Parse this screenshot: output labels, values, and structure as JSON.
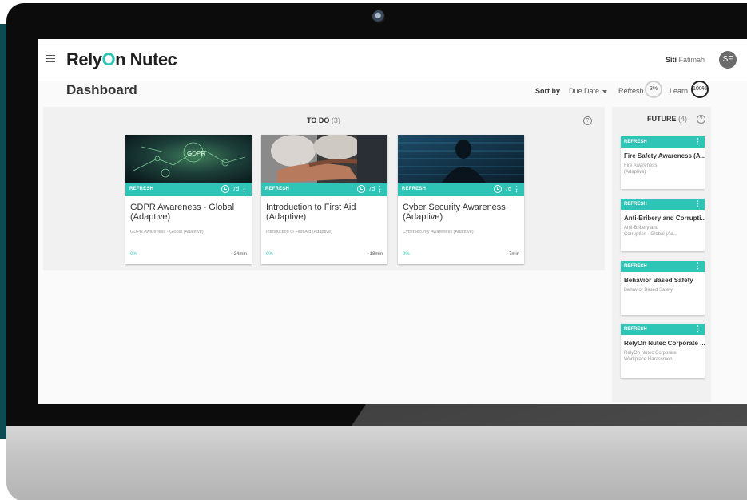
{
  "app": {
    "logo_part1": "Rely",
    "logo_o": "O",
    "logo_part2": "n Nutec"
  },
  "user": {
    "first": "Siti",
    "last": "Fatimah",
    "initials": "SF"
  },
  "page": {
    "title": "Dashboard"
  },
  "toolbar": {
    "sort_label": "Sort by",
    "sort_value": "Due Date",
    "refresh_label": "Refresh",
    "refresh_value": "3%",
    "learn_label": "Learn",
    "learn_value": "100%"
  },
  "todo": {
    "title": "TO DO",
    "count": "(3)",
    "help": "?",
    "courses": [
      {
        "tag": "REFRESH",
        "days": "7d",
        "title": "GDPR Awareness - Global (Adaptive)",
        "subtitle": "GDPR Awareness - Global (Adaptive)",
        "progress": "0%",
        "duration": "~24min",
        "thumb_text": "GDPR"
      },
      {
        "tag": "REFRESH",
        "days": "7d",
        "title": "Introduction to First Aid (Adaptive)",
        "subtitle": "Introduction to First Aid (Adaptive)",
        "progress": "0%",
        "duration": "~18min"
      },
      {
        "tag": "REFRESH",
        "days": "7d",
        "title": "Cyber Security Awareness (Adaptive)",
        "subtitle": "Cybersecurity Awareness (Adaptive)",
        "progress": "0%",
        "duration": "~7min"
      }
    ]
  },
  "future": {
    "title": "FUTURE",
    "count": "(4)",
    "help": "?",
    "courses": [
      {
        "tag": "REFRESH",
        "title": "Fire Safety Awareness (A...",
        "subtitle_line1": "Fire Awareness",
        "subtitle_line2": "(Adaptive)"
      },
      {
        "tag": "REFRESH",
        "title": "Anti-Bribery and Corrupti...",
        "subtitle_line1": "Anti-Bribery and",
        "subtitle_line2": "Corruption - Global (Ad..."
      },
      {
        "tag": "REFRESH",
        "title": "Behavior Based Safety",
        "subtitle_line1": "Behavior Based Safety",
        "subtitle_line2": ""
      },
      {
        "tag": "REFRESH",
        "title": "RelyOn Nutec Corporate ...",
        "subtitle_line1": "RelyOn Nutec Corporate",
        "subtitle_line2": "Workplace Harassment..."
      }
    ]
  },
  "colors": {
    "accent": "#2ec4b6",
    "bezel": "#0c0c0c",
    "side_teal": "#0d4a52"
  },
  "icons": [
    "menu-icon",
    "clock-icon",
    "kebab-icon",
    "help-icon",
    "camera-icon"
  ]
}
